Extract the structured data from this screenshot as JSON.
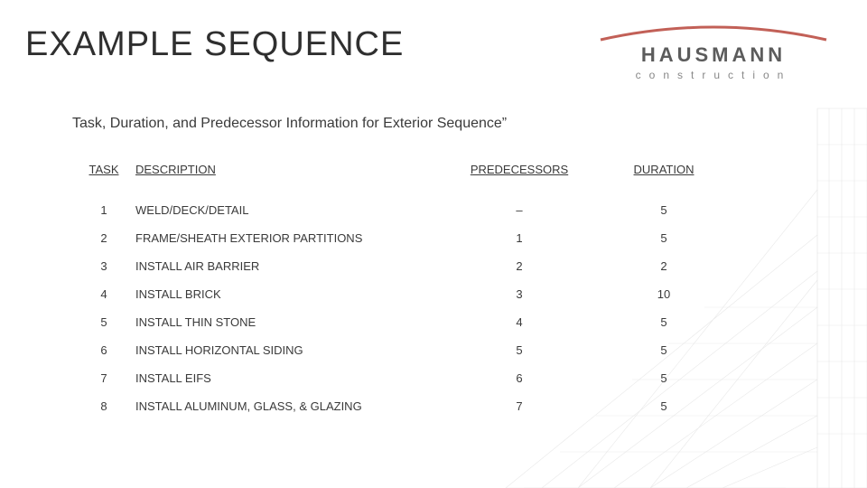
{
  "logo": {
    "brand_main": "HAUSMANN",
    "brand_sub": "construction"
  },
  "title": "EXAMPLE SEQUENCE",
  "subtitle": "Task, Duration, and Predecessor Information for Exterior Sequence”",
  "table": {
    "headers": {
      "task": "TASK",
      "description": "DESCRIPTION",
      "predecessors": "PREDECESSORS",
      "duration": "DURATION"
    },
    "rows": [
      {
        "task": "1",
        "description": "WELD/DECK/DETAIL",
        "predecessors": "–",
        "duration": "5"
      },
      {
        "task": "2",
        "description": "FRAME/SHEATH EXTERIOR PARTITIONS",
        "predecessors": "1",
        "duration": "5"
      },
      {
        "task": "3",
        "description": "INSTALL AIR BARRIER",
        "predecessors": "2",
        "duration": "2"
      },
      {
        "task": "4",
        "description": "INSTALL BRICK",
        "predecessors": "3",
        "duration": "10"
      },
      {
        "task": "5",
        "description": "INSTALL THIN STONE",
        "predecessors": "4",
        "duration": "5"
      },
      {
        "task": "6",
        "description": "INSTALL HORIZONTAL SIDING",
        "predecessors": "5",
        "duration": "5"
      },
      {
        "task": "7",
        "description": "INSTALL EIFS",
        "predecessors": "6",
        "duration": "5"
      },
      {
        "task": "8",
        "description": "INSTALL ALUMINUM, GLASS, & GLAZING",
        "predecessors": "7",
        "duration": "5"
      }
    ]
  }
}
